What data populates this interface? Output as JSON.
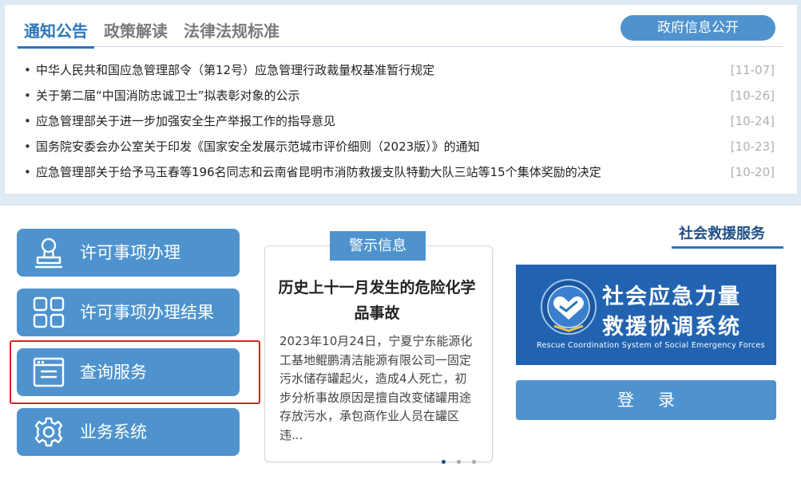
{
  "tabs": [
    {
      "label": "通知公告"
    },
    {
      "label": "政策解读"
    },
    {
      "label": "法律法规标准"
    }
  ],
  "gov_info_button": "政府信息公开",
  "news": [
    {
      "title": "中华人民共和国应急管理部令（第12号）应急管理行政裁量权基准暂行规定",
      "date": "[11-07]"
    },
    {
      "title": "关于第二届“中国消防忠诚卫士”拟表彰对象的公示",
      "date": "[10-26]"
    },
    {
      "title": "应急管理部关于进一步加强安全生产举报工作的指导意见",
      "date": "[10-24]"
    },
    {
      "title": "国务院安委会办公室关于印发《国家安全发展示范城市评价细则（2023版）》的通知",
      "date": "[10-23]"
    },
    {
      "title": "应急管理部关于给予马玉春等196名同志和云南省昆明市消防救援支队特勤大队三站等15个集体奖励的决定",
      "date": "[10-20]"
    }
  ],
  "services": [
    {
      "label": "许可事项办理",
      "icon": "stamp-icon"
    },
    {
      "label": "许可事项办理结果",
      "icon": "grid-icon"
    },
    {
      "label": "查询服务",
      "icon": "browser-window-icon"
    },
    {
      "label": "业务系统",
      "icon": "gear-icon"
    }
  ],
  "warning": {
    "tab": "警示信息",
    "title": "历史上十一月发生的危险化学品事故",
    "body": "2023年10月24日，宁夏宁东能源化工基地鲲鹏清洁能源有限公司一固定污水储存罐起火，造成4人死亡，初步分析事故原因是擅自改变储罐用途存放污水，承包商作业人员在罐区违..."
  },
  "rescue": {
    "title": "社会救援服务",
    "banner_line1": "社会应急力量",
    "banner_line2": "救援协调系统",
    "banner_en": "Rescue Coordination System of Social Emergency Forces",
    "login_label": "登录"
  },
  "colors": {
    "accent": "#4f93ce",
    "dark_blue": "#2b76b8",
    "banner_blue": "#2163b1",
    "highlight_border": "#e02020"
  }
}
